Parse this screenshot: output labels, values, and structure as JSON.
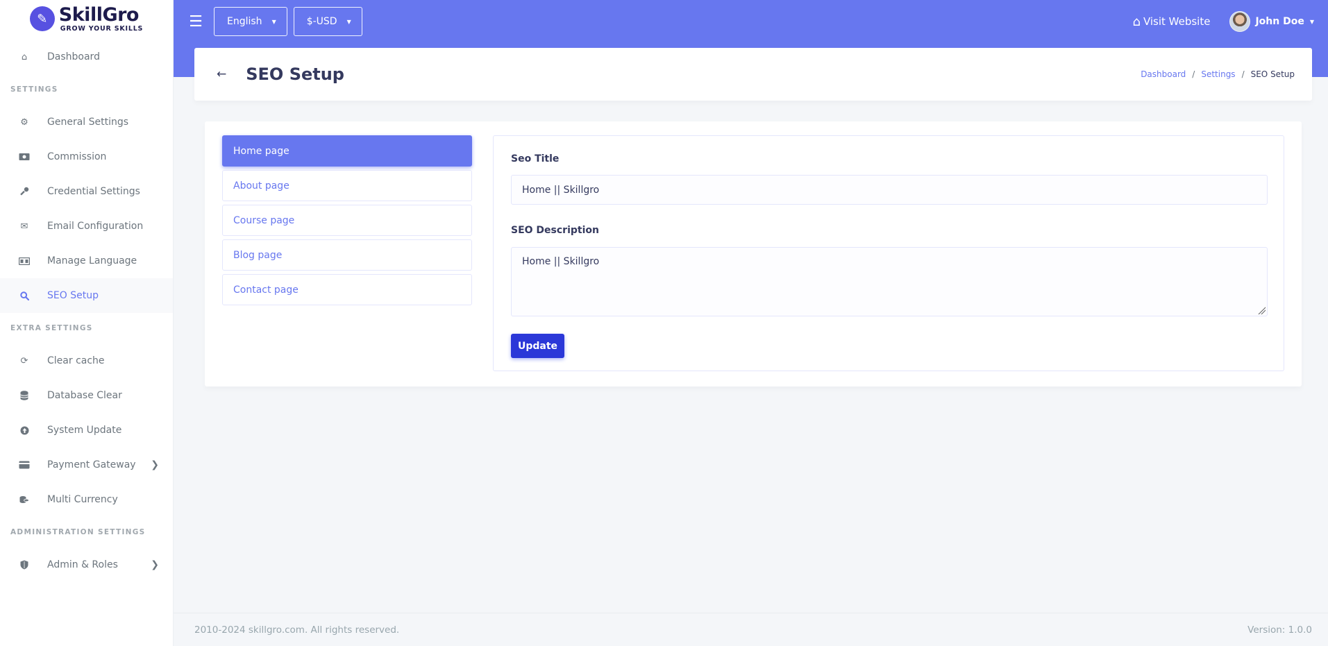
{
  "brand": {
    "name": "SkillGro",
    "tagline": "GROW YOUR SKILLS",
    "logo_color": "#5751e1"
  },
  "sidebar": {
    "dashboard": {
      "label": "Dashboard",
      "icon": "home-icon"
    },
    "sections": [
      {
        "header": "SETTINGS",
        "items": [
          {
            "label": "General Settings",
            "icon": "gear-icon"
          },
          {
            "label": "Commission",
            "icon": "money-icon"
          },
          {
            "label": "Credential Settings",
            "icon": "key-icon"
          },
          {
            "label": "Email Configuration",
            "icon": "envelope-icon"
          },
          {
            "label": "Manage Language",
            "icon": "language-icon"
          },
          {
            "label": "SEO Setup",
            "icon": "search-icon",
            "active": true
          }
        ]
      },
      {
        "header": "EXTRA SETTINGS",
        "items": [
          {
            "label": "Clear cache",
            "icon": "sync-icon"
          },
          {
            "label": "Database Clear",
            "icon": "database-icon"
          },
          {
            "label": "System Update",
            "icon": "upload-icon"
          },
          {
            "label": "Payment Gateway",
            "icon": "credit-card-icon",
            "has_submenu": true
          },
          {
            "label": "Multi Currency",
            "icon": "coins-icon"
          }
        ]
      },
      {
        "header": "ADMINISTRATION SETTINGS",
        "items": [
          {
            "label": "Admin & Roles",
            "icon": "shield-icon",
            "has_submenu": true
          }
        ]
      }
    ]
  },
  "navbar": {
    "language": "English",
    "currency": "$-USD",
    "visit_website": "Visit Website",
    "user_name": "John Doe",
    "accent": "#6777ef"
  },
  "page": {
    "title": "SEO Setup",
    "breadcrumb": [
      "Dashboard",
      "Settings",
      "SEO Setup"
    ]
  },
  "tabs": [
    {
      "label": "Home page",
      "active": true
    },
    {
      "label": "About page"
    },
    {
      "label": "Course page"
    },
    {
      "label": "Blog page"
    },
    {
      "label": "Contact page"
    }
  ],
  "form": {
    "seo_title_label": "Seo Title",
    "seo_title_value": "Home || Skillgro",
    "seo_description_label": "SEO Description",
    "seo_description_value": "Home || Skillgro",
    "update_label": "Update"
  },
  "footer": {
    "copyright": "2010-2024 skillgro.com. All rights reserved.",
    "version": "Version: 1.0.0"
  }
}
